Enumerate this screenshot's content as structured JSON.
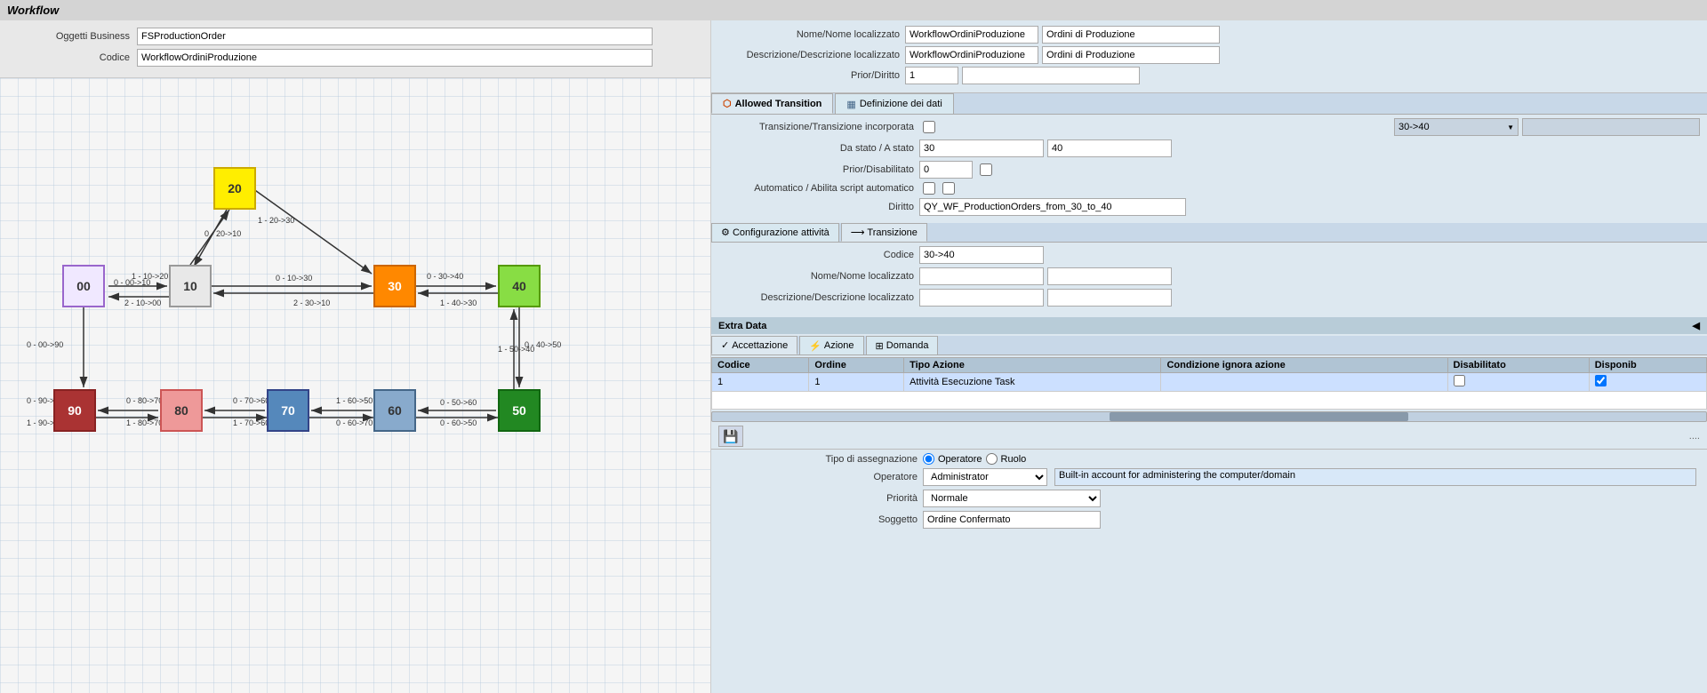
{
  "title": "Workflow",
  "left_panel": {
    "oggetti_label": "Oggetti Business",
    "codice_label": "Codice",
    "oggetti_value": "FSProductionOrder",
    "codice_value": "WorkflowOrdiniProduzione"
  },
  "right_top": {
    "nome_label": "Nome/Nome localizzato",
    "descrizione_label": "Descrizione/Descrizione localizzato",
    "prior_label": "Prior/Diritto",
    "nome_value1": "WorkflowOrdiniProduzione",
    "nome_value2": "Ordini di Produzione",
    "descrizione_value1": "WorkflowOrdiniProduzione",
    "descrizione_value2": "Ordini di Produzione",
    "prior_value": "1"
  },
  "tabs": {
    "allowed_transition": "Allowed Transition",
    "definizione_dei_dati": "Definizione dei dati"
  },
  "allowed_transition_form": {
    "transizione_label": "Transizione/Transizione incorporata",
    "da_stato_label": "Da stato / A stato",
    "prior_label": "Prior/Disabilitato",
    "automatico_label": "Automatico / Abilita script automatico",
    "diritto_label": "Diritto",
    "da_stato_value": "30",
    "a_stato_value": "40",
    "prior_value": "0",
    "diritto_value": "QY_WF_ProductionOrders_from_30_to_40",
    "dropdown_value": "30->40"
  },
  "inner_tabs": {
    "configurazione": "Configurazione attività",
    "transizione": "Transizione"
  },
  "transizione_form": {
    "codice_label": "Codice",
    "nome_label": "Nome/Nome localizzato",
    "descrizione_label": "Descrizione/Descrizione localizzato",
    "codice_value": "30->40",
    "nome_value1": "",
    "nome_value2": "",
    "descrizione_value1": "",
    "descrizione_value2": ""
  },
  "extra_data": "Extra Data",
  "action_tabs": {
    "accettazione": "Accettazione",
    "azione": "Azione",
    "domanda": "Domanda"
  },
  "table": {
    "columns": [
      "Codice",
      "Ordine",
      "Tipo Azione",
      "Condizione ignora azione",
      "Disabilitato",
      "Disponib"
    ],
    "rows": [
      {
        "codice": "1",
        "ordine": "1",
        "tipo_azione": "Attività Esecuzione Task",
        "condizione": "",
        "disabilitato": false,
        "disponib": true
      }
    ]
  },
  "bottom_form": {
    "tipo_assegnazione_label": "Tipo di assegnazione",
    "operatore_label": "Operatore",
    "ruolo_label": "Ruolo",
    "priorita_label": "Priorità",
    "soggetto_label": "Soggetto",
    "operatore_value": "Administrator",
    "operatore_desc": "Built-in account for administering the computer/domain",
    "priorita_value": "Normale",
    "soggetto_value": "Ordine Confermato"
  },
  "nodes": {
    "n00": "00",
    "n10": "10",
    "n20": "20",
    "n30": "30",
    "n40": "40",
    "n50": "50",
    "n60": "60",
    "n70": "70",
    "n80": "80",
    "n90": "90"
  },
  "arrow_labels": {
    "l1": "1 - 10->20",
    "l2": "0 - 20->10",
    "l3": "1 - 20->30",
    "l4": "0 - 00->10",
    "l5": "0 - 10->30",
    "l6": "0 - 30->40",
    "l7": "2 - 10->00",
    "l8": "2 - 30->10",
    "l9": "1 - 40->30",
    "l10": "0 - 40->50",
    "l11": "1 - 50->40",
    "l12": "0 - 50->60",
    "l13": "0 - 60->50",
    "l14": "1 - 60->50",
    "l15": "0 - 60->70",
    "l16": "0 - 70->60",
    "l17": "1 - 70->60",
    "l18": "0 - 80->70",
    "l19": "1 - 80->70",
    "l20": "0 - 90->80",
    "l21": "1 - 90->80",
    "l22": "0 - 00->90"
  }
}
